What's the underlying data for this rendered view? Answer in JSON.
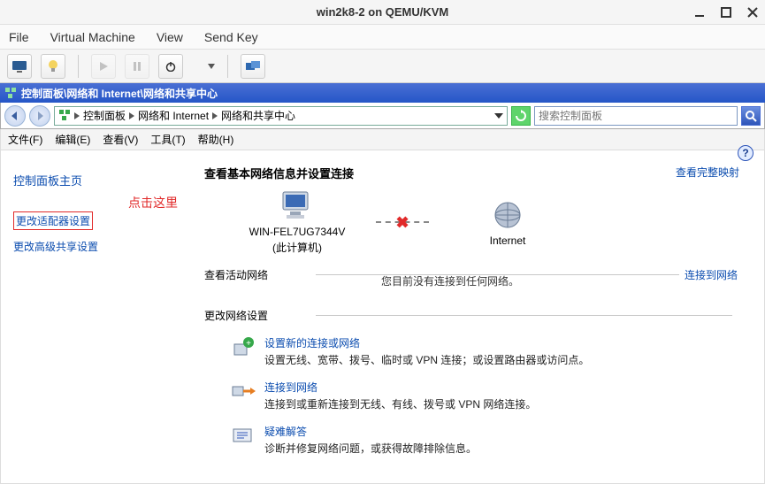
{
  "vm": {
    "title": "win2k8-2 on QEMU/KVM",
    "menu": {
      "file": "File",
      "virtual_machine": "Virtual Machine",
      "view": "View",
      "send_key": "Send Key"
    }
  },
  "win": {
    "title": "控制面板\\网络和 Internet\\网络和共享中心",
    "addr": {
      "crumb1": "控制面板",
      "crumb2": "网络和 Internet",
      "crumb3": "网络和共享中心"
    },
    "search_placeholder": "搜索控制面板",
    "menu": {
      "file": "文件(F)",
      "edit": "编辑(E)",
      "view": "查看(V)",
      "tools": "工具(T)",
      "help": "帮助(H)"
    }
  },
  "sidebar": {
    "home": "控制面板主页",
    "annotation": "点击这里",
    "adapter": "更改适配器设置",
    "advanced": "更改高级共享设置"
  },
  "main": {
    "heading": "查看基本网络信息并设置连接",
    "map_link": "查看完整映射",
    "computer_name": "WIN-FEL7UG7344V",
    "computer_sub": "(此计算机)",
    "internet": "Internet",
    "active_net_label": "查看活动网络",
    "no_connection": "您目前没有连接到任何网络。",
    "connect_link": "连接到网络",
    "change_label": "更改网络设置",
    "tasks": [
      {
        "title": "设置新的连接或网络",
        "desc": "设置无线、宽带、拨号、临时或 VPN 连接；或设置路由器或访问点。"
      },
      {
        "title": "连接到网络",
        "desc": "连接到或重新连接到无线、有线、拨号或 VPN 网络连接。"
      },
      {
        "title": "疑难解答",
        "desc": "诊断并修复网络问题，或获得故障排除信息。"
      }
    ]
  }
}
